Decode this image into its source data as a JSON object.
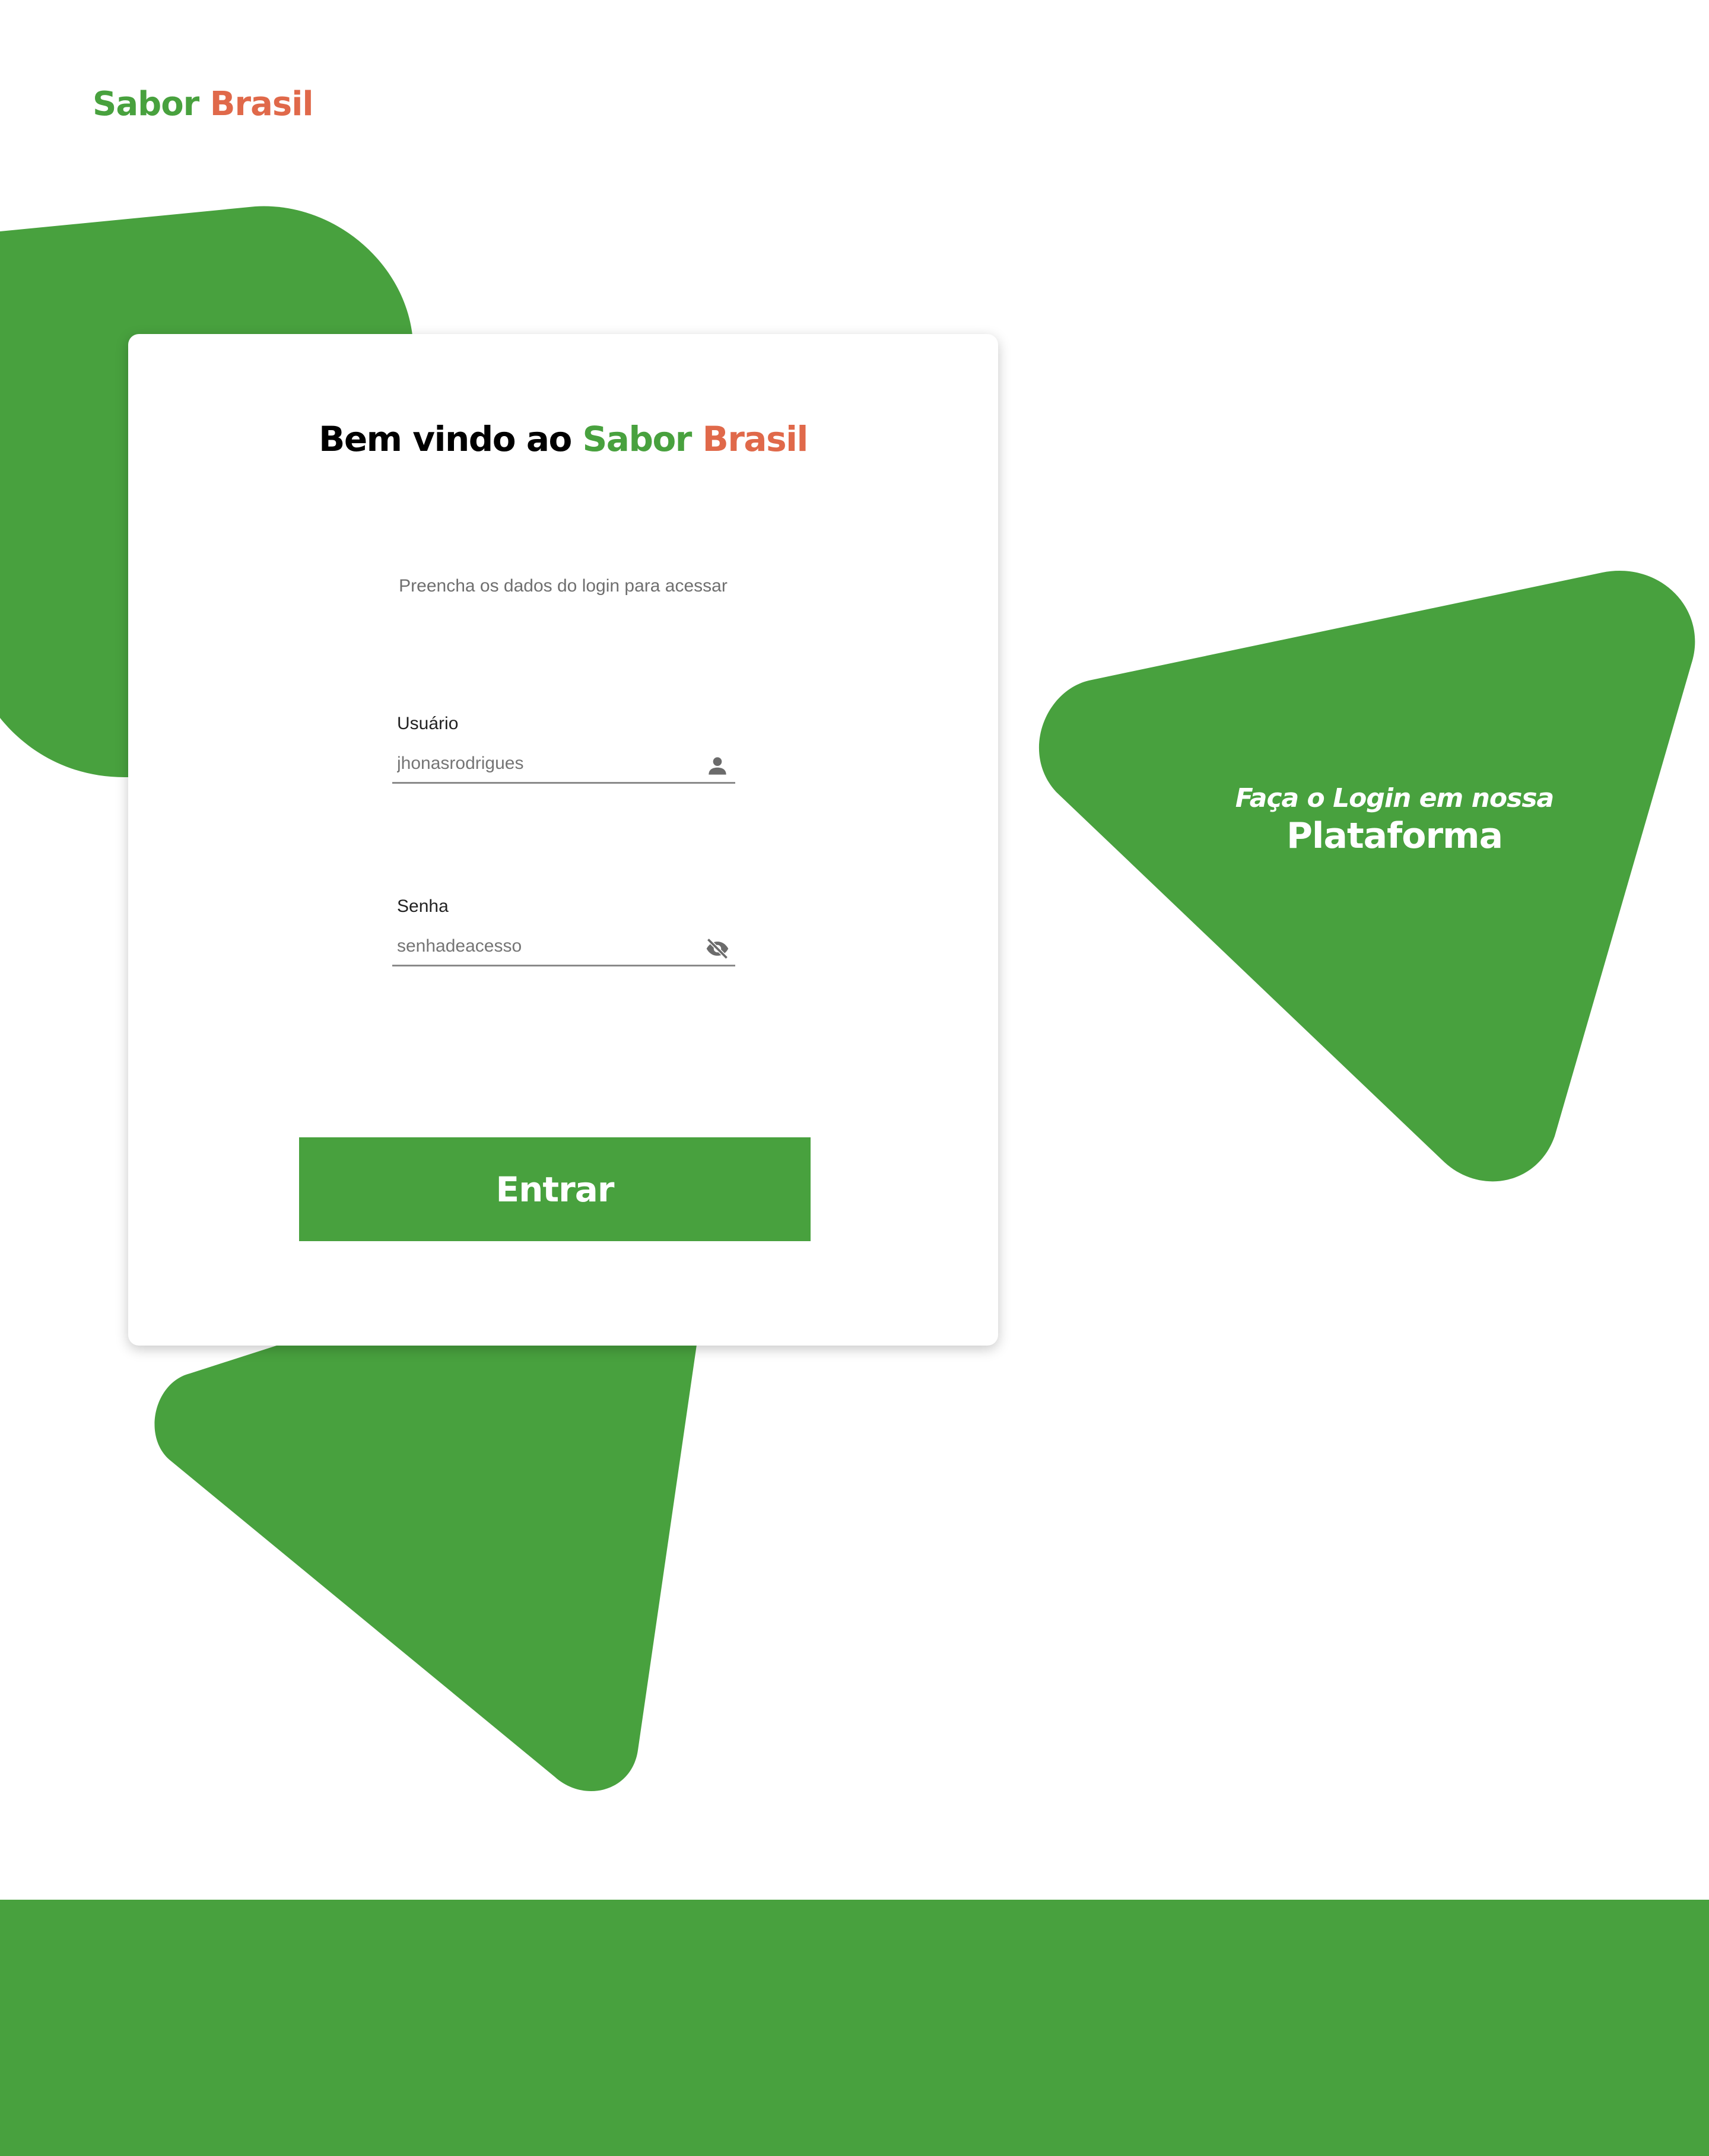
{
  "brand": {
    "part1": "Sabor",
    "part2": "Brasil",
    "colors": {
      "green": "#48a13e",
      "orange": "#e0694a"
    }
  },
  "login_card": {
    "title_prefix": "Bem vindo ao",
    "title_brand_part1": "Sabor",
    "title_brand_part2": "Brasil",
    "subtitle": "Preencha os dados do login para acessar",
    "username": {
      "label": "Usuário",
      "placeholder": "jhonasrodrigues",
      "value": "",
      "icon": "user-icon"
    },
    "password": {
      "label": "Senha",
      "placeholder": "senhadeacesso",
      "value": "",
      "icon": "eye-off-icon"
    },
    "submit_label": "Entrar"
  },
  "promo": {
    "line1": "Faça o Login em nossa",
    "line2": "Plataforma"
  }
}
